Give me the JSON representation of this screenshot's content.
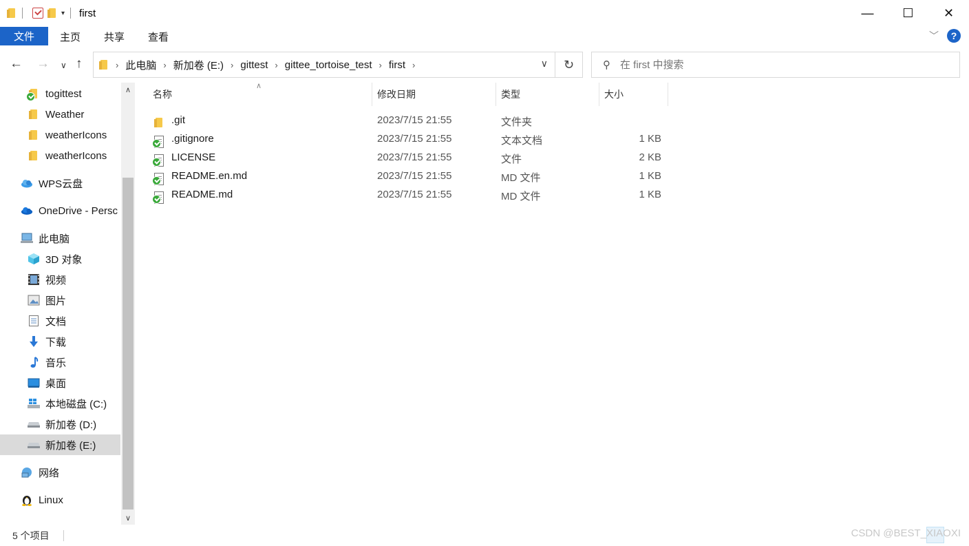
{
  "window": {
    "title": "first",
    "controls": {
      "minimize": "—",
      "maximize": "☐",
      "close": "✕"
    }
  },
  "ribbon": {
    "tabs": [
      "文件",
      "主页",
      "共享",
      "查看"
    ]
  },
  "nav": {
    "breadcrumbs": [
      "此电脑",
      "新加卷 (E:)",
      "gittest",
      "gittee_tortoise_test",
      "first"
    ],
    "search_placeholder": "在 first 中搜索"
  },
  "sidebar": {
    "items": [
      {
        "label": "togittest",
        "icon": "folder-git-ok-icon"
      },
      {
        "label": "Weather",
        "icon": "folder-icon"
      },
      {
        "label": "weatherIcons",
        "icon": "folder-icon"
      },
      {
        "label": "weatherIcons",
        "icon": "folder-icon"
      },
      {
        "label": "WPS云盘",
        "icon": "wps-cloud-icon"
      },
      {
        "label": "OneDrive - Persc",
        "icon": "onedrive-icon"
      },
      {
        "label": "此电脑",
        "icon": "computer-icon"
      },
      {
        "label": "3D 对象",
        "icon": "3d-objects-icon"
      },
      {
        "label": "视频",
        "icon": "video-icon"
      },
      {
        "label": "图片",
        "icon": "pictures-icon"
      },
      {
        "label": "文档",
        "icon": "documents-icon"
      },
      {
        "label": "下载",
        "icon": "download-icon"
      },
      {
        "label": "音乐",
        "icon": "music-icon"
      },
      {
        "label": "桌面",
        "icon": "desktop-icon"
      },
      {
        "label": "本地磁盘 (C:)",
        "icon": "windows-drive-icon"
      },
      {
        "label": "新加卷 (D:)",
        "icon": "drive-icon"
      },
      {
        "label": "新加卷 (E:)",
        "icon": "drive-icon",
        "selected": true
      },
      {
        "label": "网络",
        "icon": "network-icon"
      },
      {
        "label": "Linux",
        "icon": "linux-penguin-icon"
      }
    ]
  },
  "files": {
    "columns": [
      "名称",
      "修改日期",
      "类型",
      "大小"
    ],
    "rows": [
      {
        "name": ".git",
        "date": "2023/7/15 21:55",
        "type": "文件夹",
        "size": "",
        "icon": "folder-icon"
      },
      {
        "name": ".gitignore",
        "date": "2023/7/15 21:55",
        "type": "文本文档",
        "size": "1 KB",
        "icon": "file-git-ok-icon"
      },
      {
        "name": "LICENSE",
        "date": "2023/7/15 21:55",
        "type": "文件",
        "size": "2 KB",
        "icon": "file-git-ok-icon"
      },
      {
        "name": "README.en.md",
        "date": "2023/7/15 21:55",
        "type": "MD 文件",
        "size": "1 KB",
        "icon": "file-git-ok-icon"
      },
      {
        "name": "README.md",
        "date": "2023/7/15 21:55",
        "type": "MD 文件",
        "size": "1 KB",
        "icon": "file-git-ok-icon"
      }
    ]
  },
  "status": {
    "item_count": "5 个项目",
    "watermark": "CSDN @BEST_XIAOXI"
  }
}
